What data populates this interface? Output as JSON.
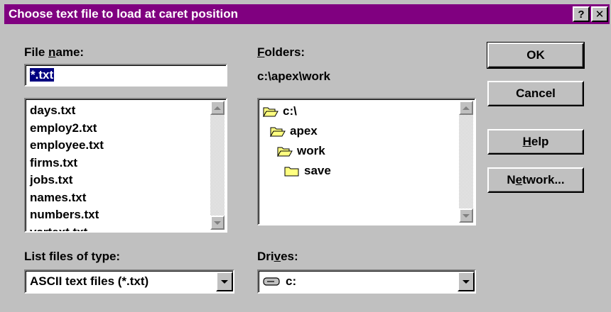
{
  "dialog": {
    "title": "Choose text file to load at caret position",
    "help_glyph": "?",
    "close_glyph": "✕"
  },
  "file_name": {
    "label_pre": "File ",
    "label_accel": "n",
    "label_post": "ame:",
    "value": "*.txt"
  },
  "files": [
    "days.txt",
    "employ2.txt",
    "employee.txt",
    "firms.txt",
    "jobs.txt",
    "names.txt",
    "numbers.txt",
    "vartext.txt"
  ],
  "folders": {
    "label_accel": "F",
    "label_post": "olders:",
    "current_path": "c:\\apex\\work",
    "tree": [
      {
        "name": "c:\\",
        "icon": "folder-open-icon",
        "level": 0
      },
      {
        "name": "apex",
        "icon": "folder-open-icon",
        "level": 1
      },
      {
        "name": "work",
        "icon": "folder-open-icon",
        "level": 2
      },
      {
        "name": "save",
        "icon": "folder-closed-icon",
        "level": 3
      }
    ]
  },
  "file_type": {
    "label": "List files of type:",
    "value": "ASCII text files (*.txt)"
  },
  "drives": {
    "label_pre": "Dri",
    "label_accel": "v",
    "label_post": "es:",
    "value": "c:",
    "icon": "drive-icon"
  },
  "buttons": {
    "ok": "OK",
    "cancel": "Cancel",
    "help_accel": "H",
    "help_post": "elp",
    "network_pre": "N",
    "network_accel": "e",
    "network_post": "twork..."
  },
  "colors": {
    "titlebar": "#800080",
    "face": "#c0c0c0",
    "selection": "#000080",
    "folder": "#ffff80"
  }
}
